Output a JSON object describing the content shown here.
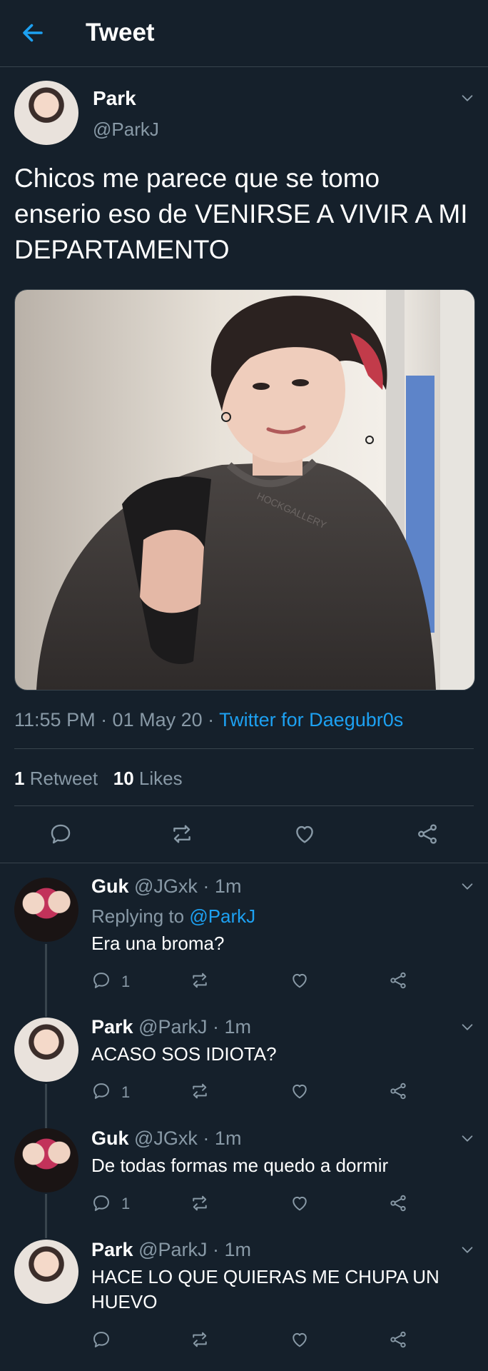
{
  "header": {
    "title": "Tweet"
  },
  "tweet": {
    "name": "Park",
    "handle": "@ParkJ",
    "text": "Chicos me parece que se tomo enserio eso de VENIRSE A VIVIR A MI DEPARTAMENTO",
    "time": "11:55 PM · 01 May 20 · ",
    "source": "Twitter for Daegubr0s",
    "retweets_count": "1",
    "retweets_label": "Retweet",
    "likes_count": "10",
    "likes_label": "Likes",
    "media_sweater_text": "HOCKGALLERY"
  },
  "replies": [
    {
      "name": "Guk",
      "meta": " @JGxk · 1m",
      "replying_label": "Replying to ",
      "replying_to": "@ParkJ",
      "text": "Era una broma?",
      "reply_count": "1"
    },
    {
      "name": "Park",
      "meta": " @ParkJ · 1m",
      "text": "ACASO SOS IDIOTA?",
      "reply_count": "1"
    },
    {
      "name": "Guk",
      "meta": " @JGxk · 1m",
      "text": "De todas formas me quedo a dormir",
      "reply_count": "1"
    },
    {
      "name": "Park",
      "meta": " @ParkJ · 1m",
      "text": "HACE LO QUE QUIERAS ME CHUPA UN HUEVO",
      "reply_count": ""
    }
  ],
  "colors": {
    "background": "#15202b",
    "accent": "#1da1f2",
    "secondary_text": "#8899a6",
    "divider": "#38444d"
  },
  "icons": [
    "back-arrow-icon",
    "chevron-down-icon",
    "reply-icon",
    "retweet-icon",
    "like-icon",
    "share-icon"
  ]
}
